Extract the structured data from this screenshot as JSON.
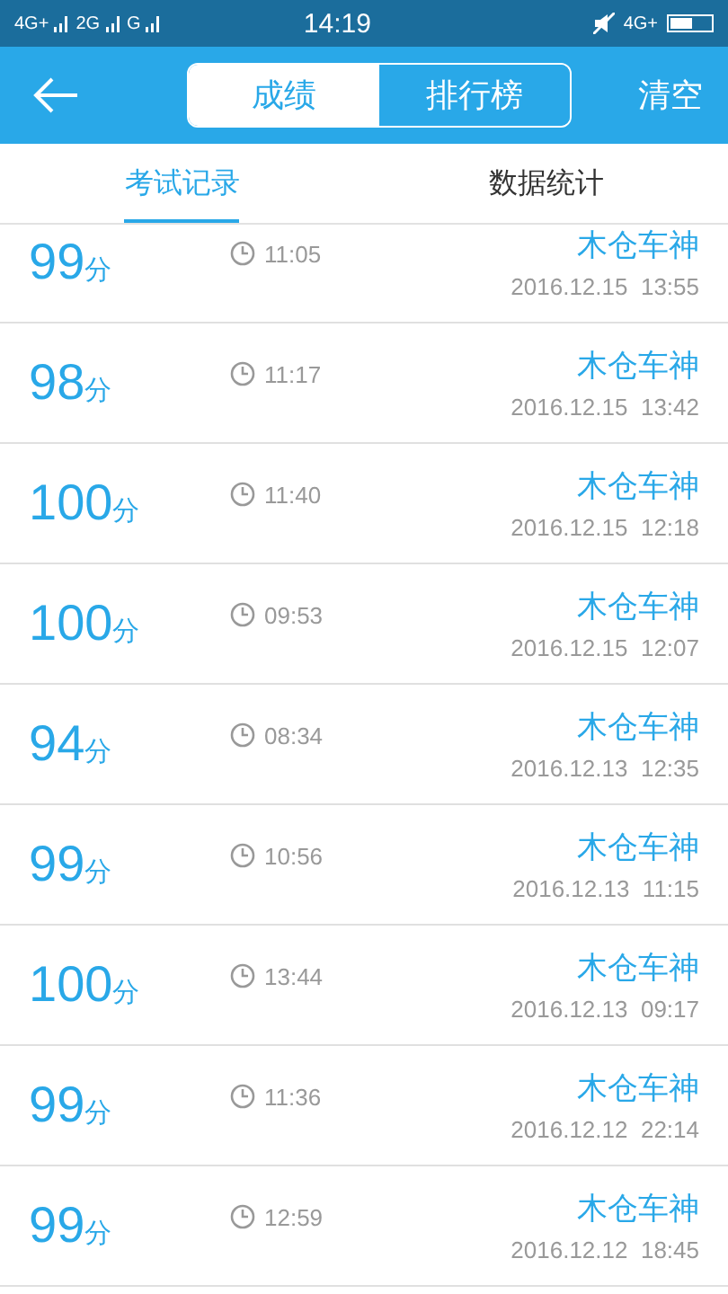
{
  "status_bar": {
    "left": [
      "4G+",
      "2G",
      "G"
    ],
    "time": "14:19",
    "right": "4G+"
  },
  "header": {
    "segments": [
      {
        "label": "成绩",
        "selected": true
      },
      {
        "label": "排行榜",
        "selected": false
      }
    ],
    "action": "清空"
  },
  "tabs": [
    {
      "label": "考试记录",
      "selected": true
    },
    {
      "label": "数据统计",
      "selected": false
    }
  ],
  "records": [
    {
      "score": "99",
      "unit": "分",
      "duration": "11:05",
      "name": "木仓车神",
      "date": "2016.12.15  13:55"
    },
    {
      "score": "98",
      "unit": "分",
      "duration": "11:17",
      "name": "木仓车神",
      "date": "2016.12.15  13:42"
    },
    {
      "score": "100",
      "unit": "分",
      "duration": "11:40",
      "name": "木仓车神",
      "date": "2016.12.15  12:18"
    },
    {
      "score": "100",
      "unit": "分",
      "duration": "09:53",
      "name": "木仓车神",
      "date": "2016.12.15  12:07"
    },
    {
      "score": "94",
      "unit": "分",
      "duration": "08:34",
      "name": "木仓车神",
      "date": "2016.12.13  12:35"
    },
    {
      "score": "99",
      "unit": "分",
      "duration": "10:56",
      "name": "木仓车神",
      "date": "2016.12.13  11:15"
    },
    {
      "score": "100",
      "unit": "分",
      "duration": "13:44",
      "name": "木仓车神",
      "date": "2016.12.13  09:17"
    },
    {
      "score": "99",
      "unit": "分",
      "duration": "11:36",
      "name": "木仓车神",
      "date": "2016.12.12  22:14"
    },
    {
      "score": "99",
      "unit": "分",
      "duration": "12:59",
      "name": "木仓车神",
      "date": "2016.12.12  18:45"
    }
  ]
}
